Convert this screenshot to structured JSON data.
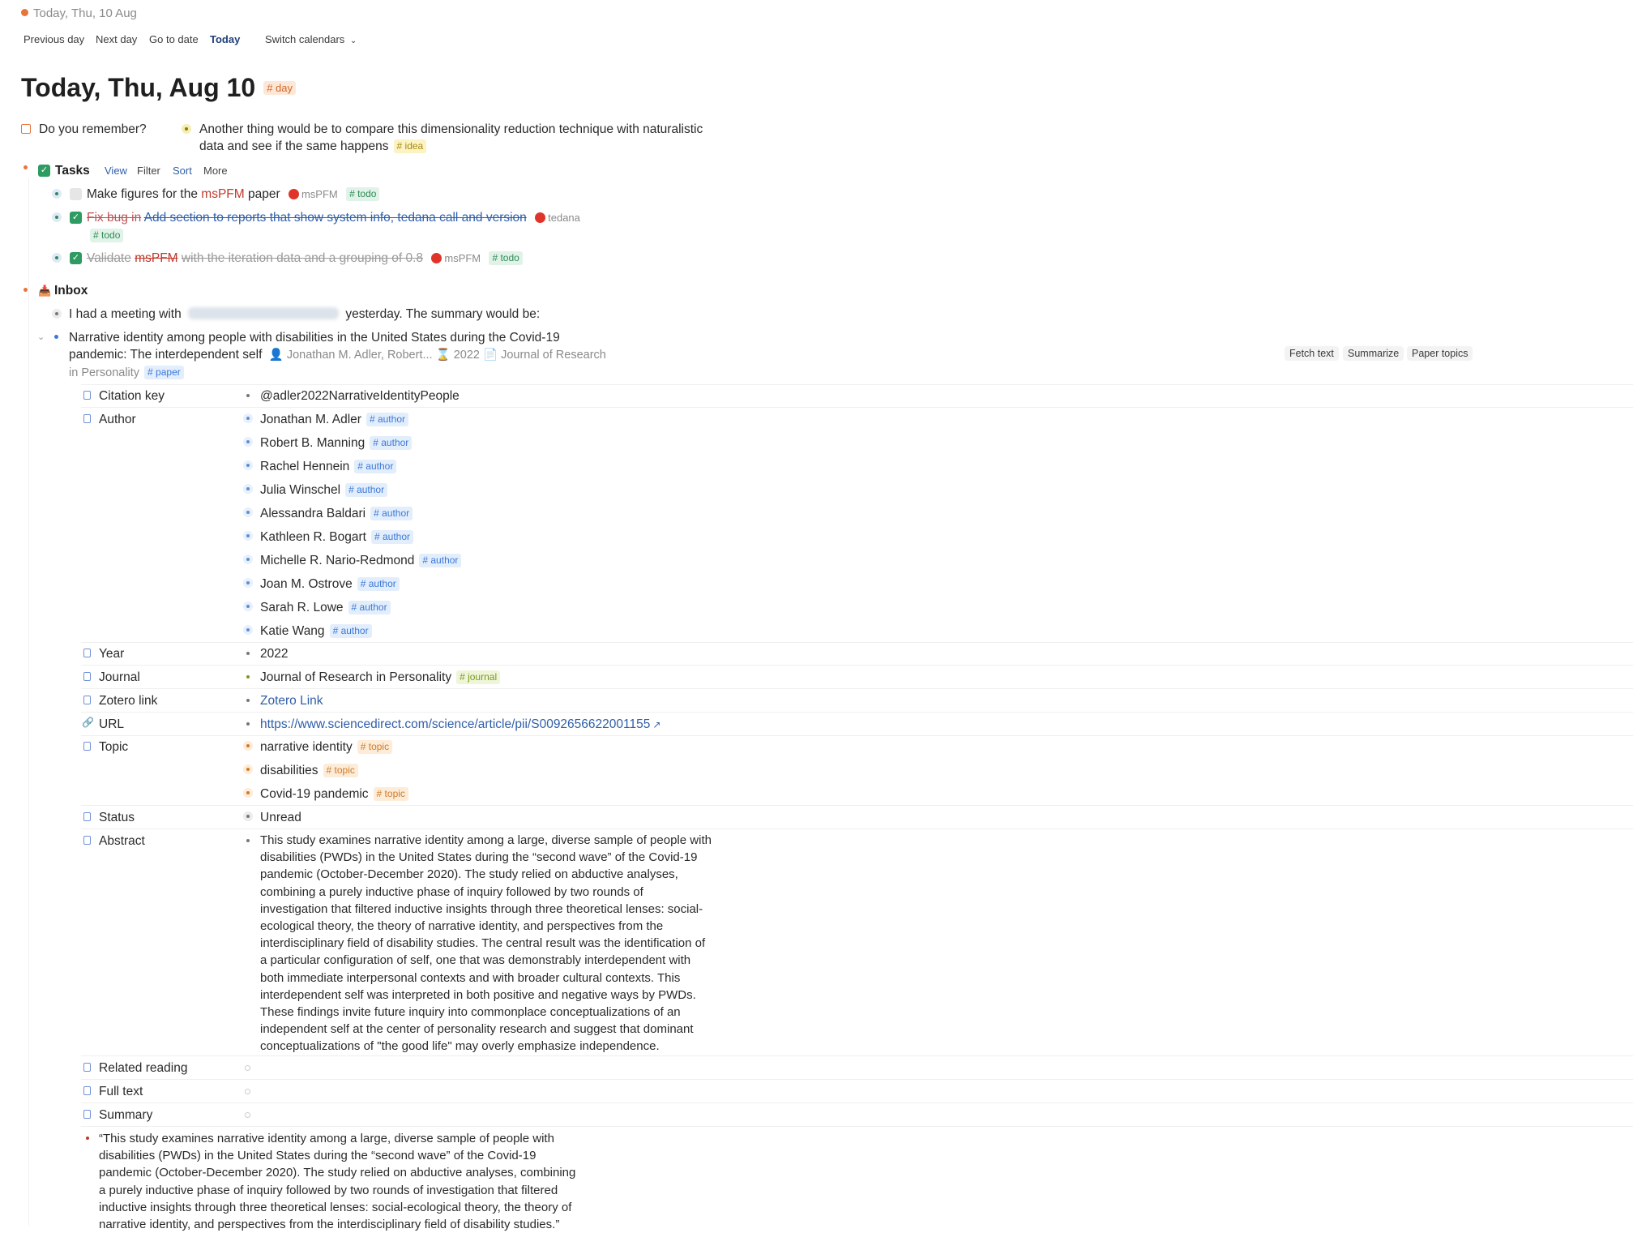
{
  "header": {
    "breadcrumb": "Today, Thu, 10 Aug",
    "nav": {
      "previous_day": "Previous day",
      "next_day": "Next day",
      "go_to_date": "Go to date",
      "today": "Today",
      "switch_calendars": "Switch calendars"
    }
  },
  "page": {
    "title": "Today, Thu, Aug 10",
    "title_tag": "# day"
  },
  "notes": {
    "remember": "Do you remember?",
    "another_thing_line1": "Another thing would be to compare this dimensionality reduction technique with naturalistic",
    "another_thing_line2": "data and see if the same happens",
    "idea_tag": "# idea"
  },
  "tasks": {
    "label": "Tasks",
    "view": "View",
    "filter": "Filter",
    "sort": "Sort",
    "more": "More",
    "items": [
      {
        "pre": "Make figures for the",
        "highlight": "msPFM",
        "post": "paper",
        "ref": "msPFM",
        "tag": "# todo"
      },
      {
        "pre": "Fix bug in",
        "link": "Add section to reports that show system info, tedana call and version",
        "ref": "tedana",
        "tag": "# todo"
      },
      {
        "pre": "Validate",
        "highlight": "msPFM",
        "post": "with the iteration data and a grouping of 0.8",
        "ref": "msPFM",
        "tag": "# todo"
      }
    ]
  },
  "inbox": {
    "label": "Inbox",
    "meeting_pre": "I had a meeting with",
    "meeting_post": "yesterday. The summary would be:",
    "paper": {
      "title_line1": "Narrative identity among people with disabilities in the United States during the Covid-19",
      "title_line2": "pandemic: The interdependent self",
      "meta_authors": "Jonathan M. Adler, Robert...",
      "meta_year": "2022",
      "meta_journal_a": "Journal of Research",
      "meta_journal_b": "in Personality",
      "tag": "# paper",
      "actions": {
        "fetch_text": "Fetch text",
        "summarize": "Summarize",
        "paper_topics": "Paper topics"
      }
    }
  },
  "fields": {
    "citation_key": {
      "label": "Citation key",
      "value": "@adler2022NarrativeIdentityPeople"
    },
    "author": {
      "label": "Author",
      "tag": "# author",
      "values": [
        "Jonathan M. Adler",
        "Robert B. Manning",
        "Rachel Hennein",
        "Julia Winschel",
        "Alessandra Baldari",
        "Kathleen R. Bogart",
        "Michelle R. Nario-Redmond",
        "Joan M. Ostrove",
        "Sarah R. Lowe",
        "Katie Wang"
      ]
    },
    "year": {
      "label": "Year",
      "value": "2022"
    },
    "journal": {
      "label": "Journal",
      "value": "Journal of Research in Personality",
      "tag": "# journal"
    },
    "zotero": {
      "label": "Zotero link",
      "value": "Zotero Link"
    },
    "url": {
      "label": "URL",
      "value": "https://www.sciencedirect.com/science/article/pii/S0092656622001155"
    },
    "topic": {
      "label": "Topic",
      "tag": "# topic",
      "values": [
        "narrative identity",
        "disabilities",
        "Covid-19 pandemic"
      ]
    },
    "status": {
      "label": "Status",
      "value": "Unread"
    },
    "abstract": {
      "label": "Abstract",
      "lines": [
        "This study examines narrative identity among a large, diverse sample of people with",
        "disabilities (PWDs) in the United States during the “second wave” of the Covid-19",
        "pandemic (October-December 2020). The study relied on abductive analyses,",
        "combining a purely inductive phase of inquiry followed by two rounds of",
        "investigation that filtered inductive insights through three theoretical lenses: social-",
        "ecological theory, the theory of narrative identity, and perspectives from the",
        "interdisciplinary field of disability studies. The central result was the identification of",
        "a particular configuration of self, one that was demonstrably interdependent with",
        "both immediate interpersonal contexts and with broader cultural contexts. This",
        "interdependent self was interpreted in both positive and negative ways by PWDs.",
        "These findings invite future inquiry into commonplace conceptualizations of an",
        "independent self at the center of personality research and suggest that dominant",
        "conceptualizations of \"the good life\" may overly emphasize independence."
      ]
    },
    "related_reading": {
      "label": "Related reading"
    },
    "full_text": {
      "label": "Full text"
    },
    "summary": {
      "label": "Summary"
    }
  },
  "quote": {
    "lines": [
      "“This study examines narrative identity among a large, diverse sample of people with",
      "disabilities (PWDs) in the United States during the “second wave” of the Covid-19",
      "pandemic (October-December 2020). The study relied on abductive analyses, combining",
      "a purely inductive phase of inquiry followed by two rounds of investigation that filtered",
      "inductive insights through three theoretical lenses: social-ecological theory, the theory of",
      "narrative identity, and perspectives from the interdisciplinary field of disability studies.”"
    ]
  },
  "colors": {
    "accent_blue": "#2f5fa8",
    "task_green": "#2e9b62",
    "strike_red": "#c0392b",
    "ref_red": "#e0342a",
    "inbox_orange": "#d0662a"
  }
}
